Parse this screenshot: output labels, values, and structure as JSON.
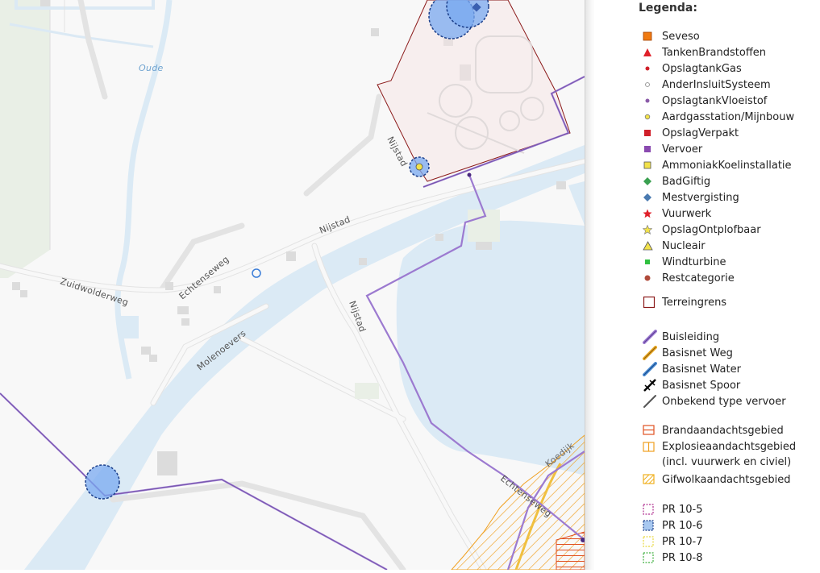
{
  "map": {
    "road_labels": {
      "nijstad_top": "Nijstad",
      "nijstad_mid": "Nijstad",
      "nijstad_south": "Nijstad",
      "echtenseweg_w": "Echtenseweg",
      "echtenseweg_se": "Echtenseweg",
      "zuidwolderweg": "Zuidwolderweg",
      "molenoevers": "Molenoevers",
      "koedijk": "Koedijk",
      "oude": "Oude"
    },
    "colors": {
      "water": "#dbeaf5",
      "pipeline": "#9c7ad0",
      "terrain_border": "#8b1a1a",
      "hazard_hatch": "#f0a020",
      "pr_circle": "#5b8fe0"
    }
  },
  "legend": {
    "title": "Legenda:",
    "items": {
      "seveso": "Seveso",
      "tanken": "TankenBrandstoffen",
      "opslag_gas": "OpslagtankGas",
      "ander": "AnderInsluitSysteem",
      "vloeistof": "OpslagtankVloeistof",
      "aardgas": "Aardgasstation/Mijnbouw",
      "verpakt": "OpslagVerpakt",
      "vervoer": "Vervoer",
      "ammoniak": "AmmoniakKoelinstallatie",
      "badgiftig": "BadGiftig",
      "mest": "Mestvergisting",
      "vuurwerk": "Vuurwerk",
      "ontplof": "OpslagOntplofbaar",
      "nucleair": "Nucleair",
      "wind": "Windturbine",
      "rest": "Restcategorie",
      "terrein": "Terreingrens",
      "buis": "Buisleiding",
      "weg": "Basisnet Weg",
      "water": "Basisnet Water",
      "spoor": "Basisnet Spoor",
      "onbekend": "Onbekend type vervoer",
      "brand": "Brandaandachtsgebied",
      "explosie_1": "Explosieaandachtsgebied",
      "explosie_2": "(incl. vuurwerk en civiel)",
      "gifwolk": "Gifwolkaandachtsgebied",
      "pr5": "PR 10-5",
      "pr6": "PR 10-6",
      "pr7": "PR 10-7",
      "pr8": "PR 10-8"
    }
  }
}
